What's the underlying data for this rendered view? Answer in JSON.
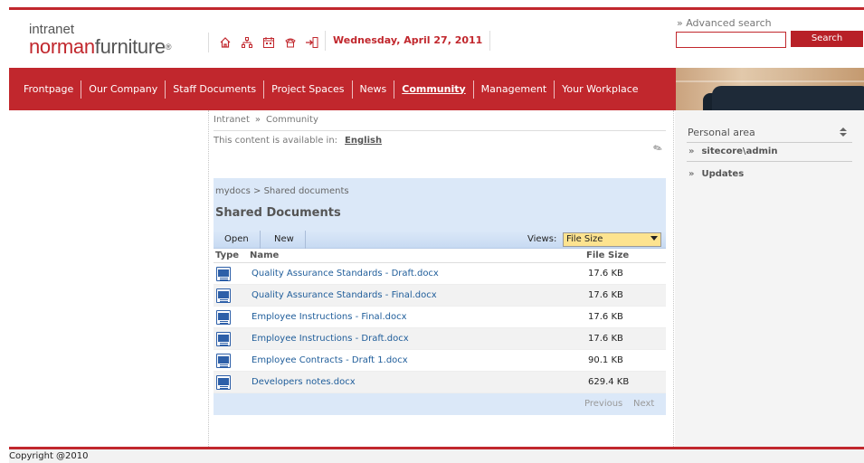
{
  "header": {
    "logo_small": "intranet",
    "logo_red": "norman",
    "logo_dark": "furniture",
    "logo_reg": "®",
    "date": "Wednesday, April 27, 2011",
    "icons": [
      "home-icon",
      "sitemap-icon",
      "calendar-icon",
      "phone-icon",
      "logout-icon"
    ]
  },
  "search": {
    "advanced_label": "» Advanced search",
    "placeholder": "",
    "button_label": "Search"
  },
  "nav": {
    "items": [
      "Frontpage",
      "Our Company",
      "Staff Documents",
      "Project Spaces",
      "News",
      "Community",
      "Management",
      "Your Workplace"
    ],
    "active": "Community"
  },
  "breadcrumb": {
    "home": "Intranet",
    "separator": "»",
    "current": "Community"
  },
  "availability": {
    "label": "This content is available in:",
    "language": "English"
  },
  "doclib": {
    "path": "mydocs > Shared documents",
    "title": "Shared Documents",
    "toolbar": {
      "open": "Open",
      "new": "New",
      "views_label": "Views:",
      "views_selected": "File Size"
    },
    "columns": {
      "type": "Type",
      "name": "Name",
      "size": "File Size"
    },
    "rows": [
      {
        "name": "Quality Assurance Standards - Draft.docx",
        "size": "17.6 KB"
      },
      {
        "name": "Quality Assurance Standards - Final.docx",
        "size": "17.6 KB"
      },
      {
        "name": "Employee Instructions - Final.docx",
        "size": "17.6 KB"
      },
      {
        "name": "Employee Instructions - Draft.docx",
        "size": "17.6 KB"
      },
      {
        "name": "Employee Contracts - Draft 1.docx",
        "size": "90.1 KB"
      },
      {
        "name": "Developers notes.docx",
        "size": "629.4 KB"
      }
    ],
    "pager": {
      "previous": "Previous",
      "next": "Next"
    }
  },
  "personal_area": {
    "title": "Personal area",
    "items": [
      "sitecore\\admin",
      "Updates"
    ],
    "bullet": "»"
  },
  "footer": {
    "copyright": "Copyright @2010"
  },
  "colors": {
    "brand_red": "#c1272d",
    "list_header_blue": "#dbe8f8",
    "link_blue": "#1f5d9a",
    "views_yellow": "#fde38f"
  }
}
